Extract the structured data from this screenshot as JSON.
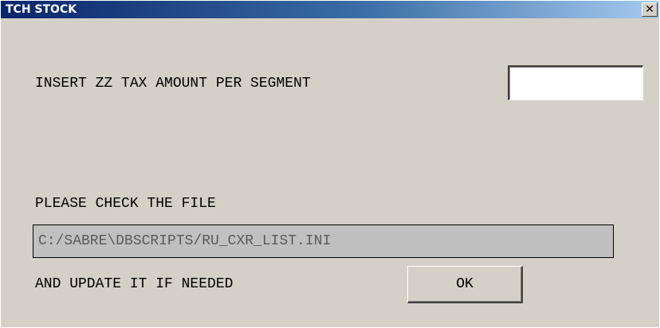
{
  "window": {
    "title": "TCH STOCK",
    "close_glyph": "×"
  },
  "form": {
    "tax_label": "INSERT ZZ TAX AMOUNT PER SEGMENT",
    "tax_value": "",
    "check_label": "PLEASE CHECK THE FILE",
    "file_path": "C:/SABRE\\DBSCRIPTS/RU_CXR_LIST.INI",
    "update_label": "AND UPDATE IT IF NEEDED",
    "ok_label": "OK"
  },
  "colors": {
    "title_gradient_start": "#0a246a",
    "title_gradient_end": "#a6caf0",
    "window_bg": "#d4d0c8",
    "path_field_bg": "#c0c0c0"
  }
}
